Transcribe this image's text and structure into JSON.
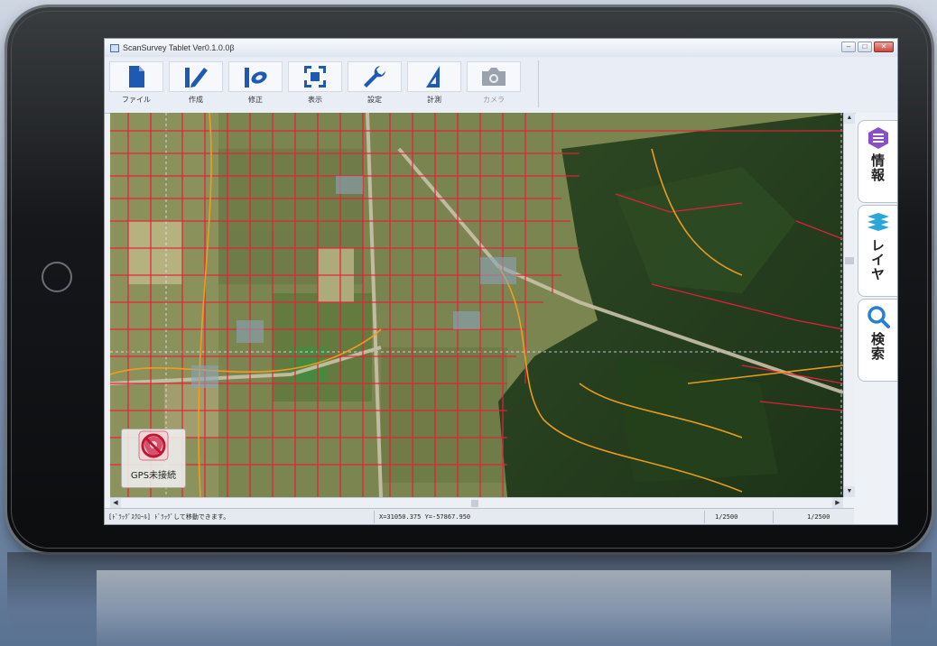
{
  "window": {
    "title": "ScanSurvey Tablet Ver0.1.0.0β",
    "controls": [
      "minimize",
      "maximize",
      "close"
    ]
  },
  "toolbar": {
    "buttons": [
      {
        "label": "ファイル",
        "icon": "file-icon",
        "enabled": true
      },
      {
        "label": "作成",
        "icon": "pen-create-icon",
        "enabled": true
      },
      {
        "label": "修正",
        "icon": "edit-eraser-icon",
        "enabled": true
      },
      {
        "label": "表示",
        "icon": "view-frame-icon",
        "enabled": true
      },
      {
        "label": "設定",
        "icon": "wrench-icon",
        "enabled": true
      },
      {
        "label": "計測",
        "icon": "measure-triangle-icon",
        "enabled": true
      },
      {
        "label": "カメラ",
        "icon": "camera-icon",
        "enabled": false
      }
    ]
  },
  "side_tabs": [
    {
      "label": "情報",
      "icon": "info-list-icon",
      "color": "#8a4fc8"
    },
    {
      "label": "レイヤ",
      "icon": "layers-icon",
      "color": "#2aa6d8"
    },
    {
      "label": "検索",
      "icon": "search-icon",
      "color": "#2a7fd0"
    }
  ],
  "gps": {
    "label": "GPS未接続",
    "icon": "gps-disconnected-icon"
  },
  "statusbar": {
    "mode": "[ﾄﾞﾗｯｸﾞｽｸﾛｰﾙ] ﾄﾞﾗｯｸﾞして移動できます。",
    "coords": "X=31050.375 Y=-57867.950",
    "scale1": "1/2500",
    "scale2": "1/2500"
  },
  "colors": {
    "parcel_lines": "#e8203a",
    "road_lines": "#f0a020",
    "guide_lines": "#e8e8ff"
  }
}
